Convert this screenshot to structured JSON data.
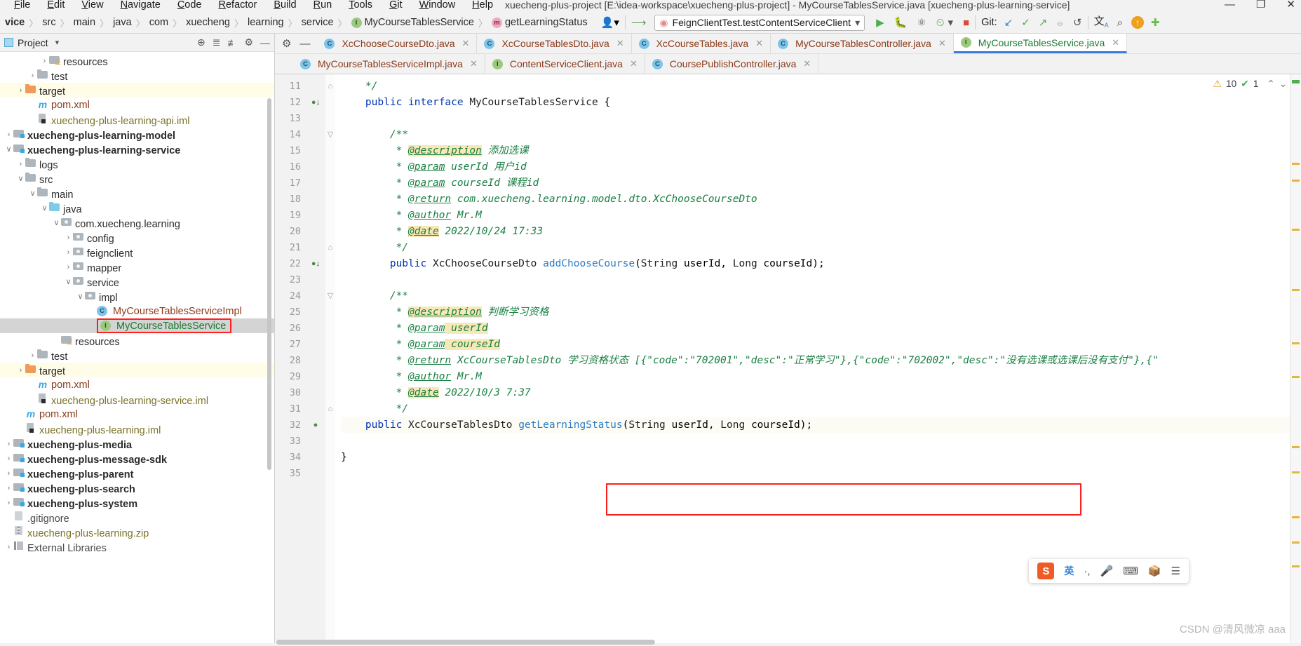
{
  "window": {
    "title": "xuecheng-plus-project [E:\\idea-workspace\\xuecheng-plus-project] - MyCourseTablesService.java [xuecheng-plus-learning-service]",
    "minimize": "—",
    "maximize": "❐",
    "close": "✕"
  },
  "menu": {
    "items": [
      "File",
      "Edit",
      "View",
      "Navigate",
      "Code",
      "Refactor",
      "Build",
      "Run",
      "Tools",
      "Git",
      "Window",
      "Help"
    ]
  },
  "breadcrumbs": {
    "items": [
      {
        "label": "vice",
        "bold": true,
        "icon": ""
      },
      {
        "label": "src",
        "bold": false,
        "icon": ""
      },
      {
        "label": "main",
        "bold": false,
        "icon": ""
      },
      {
        "label": "java",
        "bold": false,
        "icon": ""
      },
      {
        "label": "com",
        "bold": false,
        "icon": ""
      },
      {
        "label": "xuecheng",
        "bold": false,
        "icon": ""
      },
      {
        "label": "learning",
        "bold": false,
        "icon": ""
      },
      {
        "label": "service",
        "bold": false,
        "icon": ""
      },
      {
        "label": "MyCourseTablesService",
        "bold": false,
        "icon": "I"
      },
      {
        "label": "getLearningStatus",
        "bold": false,
        "icon": "m"
      }
    ]
  },
  "toolbar": {
    "profile_icon": "user-dropdown",
    "hammer_icon": "build-icon",
    "run_config": "FeignClientTest.testContentServiceClient",
    "run_icon": "▶",
    "debug_icon": "debug-icon",
    "coverage_icon": "run-with-coverage",
    "profiler_icon": "profile-icon",
    "stop_icon": "■",
    "git_label": "Git:",
    "git_update": "↙",
    "git_commit": "✓",
    "git_push": "↗",
    "git_history": "⦵",
    "git_rollback": "↺",
    "translate_icon": "translate-icon",
    "search_icon": "⌕",
    "updates_icon": "↑",
    "plugin_icon": "plugin-icon"
  },
  "project_panel": {
    "title": "Project",
    "dropdown": "▾",
    "locate_icon": "⊕",
    "expand_icon": "expand-all-icon",
    "collapse_icon": "collapse-all-icon",
    "settings_icon": "⚙",
    "hide_icon": "—",
    "tree": [
      {
        "indent": 3,
        "arrow": "›",
        "icon": "f-res",
        "label": "resources",
        "cls": "c-folder",
        "state": ""
      },
      {
        "indent": 2,
        "arrow": "›",
        "icon": "f-gray",
        "label": "test",
        "cls": "c-folder",
        "state": ""
      },
      {
        "indent": 1,
        "arrow": "›",
        "icon": "f-orange",
        "label": "target",
        "cls": "c-folder",
        "state": "hl-yellow"
      },
      {
        "indent": 2,
        "arrow": "",
        "icon": "ico-m",
        "label": "pom.xml",
        "cls": "c-xml",
        "state": ""
      },
      {
        "indent": 2,
        "arrow": "",
        "icon": "ico-iml",
        "label": "xuecheng-plus-learning-api.iml",
        "cls": "c-iml",
        "state": ""
      },
      {
        "indent": 0,
        "arrow": "›",
        "icon": "f-mod",
        "label": "xuecheng-plus-learning-model",
        "cls": "c-folder bold",
        "state": ""
      },
      {
        "indent": 0,
        "arrow": "∨",
        "icon": "f-mod",
        "label": "xuecheng-plus-learning-service",
        "cls": "c-folder bold",
        "state": ""
      },
      {
        "indent": 1,
        "arrow": "›",
        "icon": "f-gray",
        "label": "logs",
        "cls": "c-folder",
        "state": ""
      },
      {
        "indent": 1,
        "arrow": "∨",
        "icon": "f-gray",
        "label": "src",
        "cls": "c-folder",
        "state": ""
      },
      {
        "indent": 2,
        "arrow": "∨",
        "icon": "f-gray",
        "label": "main",
        "cls": "c-folder",
        "state": ""
      },
      {
        "indent": 3,
        "arrow": "∨",
        "icon": "f-blue",
        "label": "java",
        "cls": "c-folder",
        "state": ""
      },
      {
        "indent": 4,
        "arrow": "∨",
        "icon": "f-pkg",
        "label": "com.xuecheng.learning",
        "cls": "c-folder",
        "state": ""
      },
      {
        "indent": 5,
        "arrow": "›",
        "icon": "f-pkg",
        "label": "config",
        "cls": "c-folder",
        "state": ""
      },
      {
        "indent": 5,
        "arrow": "›",
        "icon": "f-pkg",
        "label": "feignclient",
        "cls": "c-folder",
        "state": ""
      },
      {
        "indent": 5,
        "arrow": "›",
        "icon": "f-pkg",
        "label": "mapper",
        "cls": "c-folder",
        "state": ""
      },
      {
        "indent": 5,
        "arrow": "∨",
        "icon": "f-pkg",
        "label": "service",
        "cls": "c-folder",
        "state": ""
      },
      {
        "indent": 6,
        "arrow": "∨",
        "icon": "f-pkg",
        "label": "impl",
        "cls": "c-folder",
        "state": ""
      },
      {
        "indent": 7,
        "arrow": "",
        "icon": "badge-c",
        "label": "MyCourseTablesServiceImpl",
        "cls": "c-brown",
        "state": ""
      },
      {
        "indent": 7,
        "arrow": "",
        "icon": "badge-i",
        "label": "MyCourseTablesService",
        "cls": "c-green",
        "state": "sel redbox"
      },
      {
        "indent": 4,
        "arrow": "",
        "icon": "f-res",
        "label": "resources",
        "cls": "c-folder",
        "state": ""
      },
      {
        "indent": 2,
        "arrow": "›",
        "icon": "f-gray",
        "label": "test",
        "cls": "c-folder",
        "state": ""
      },
      {
        "indent": 1,
        "arrow": "›",
        "icon": "f-orange",
        "label": "target",
        "cls": "c-folder",
        "state": "hl-yellow"
      },
      {
        "indent": 2,
        "arrow": "",
        "icon": "ico-m",
        "label": "pom.xml",
        "cls": "c-xml",
        "state": ""
      },
      {
        "indent": 2,
        "arrow": "",
        "icon": "ico-iml",
        "label": "xuecheng-plus-learning-service.iml",
        "cls": "c-iml",
        "state": ""
      },
      {
        "indent": 1,
        "arrow": "",
        "icon": "ico-m",
        "label": "pom.xml",
        "cls": "c-xml",
        "state": ""
      },
      {
        "indent": 1,
        "arrow": "",
        "icon": "ico-iml",
        "label": "xuecheng-plus-learning.iml",
        "cls": "c-iml",
        "state": ""
      },
      {
        "indent": 0,
        "arrow": "›",
        "icon": "f-mod",
        "label": "xuecheng-plus-media",
        "cls": "c-folder bold",
        "state": ""
      },
      {
        "indent": 0,
        "arrow": "›",
        "icon": "f-mod",
        "label": "xuecheng-plus-message-sdk",
        "cls": "c-folder bold",
        "state": ""
      },
      {
        "indent": 0,
        "arrow": "›",
        "icon": "f-mod",
        "label": "xuecheng-plus-parent",
        "cls": "c-folder bold",
        "state": ""
      },
      {
        "indent": 0,
        "arrow": "›",
        "icon": "f-mod",
        "label": "xuecheng-plus-search",
        "cls": "c-folder bold",
        "state": ""
      },
      {
        "indent": 0,
        "arrow": "›",
        "icon": "f-mod",
        "label": "xuecheng-plus-system",
        "cls": "c-folder bold",
        "state": ""
      },
      {
        "indent": 0,
        "arrow": "",
        "icon": "ico-git",
        "label": ".gitignore",
        "cls": "c-dim",
        "state": ""
      },
      {
        "indent": 0,
        "arrow": "",
        "icon": "ico-zip",
        "label": "xuecheng-plus-learning.zip",
        "cls": "c-zip",
        "state": ""
      },
      {
        "indent": 0,
        "arrow": "›",
        "icon": "ico-lib",
        "label": "External Libraries",
        "cls": "c-dim",
        "state": ""
      }
    ]
  },
  "editor_tabs": {
    "row1": [
      {
        "label": "XcChooseCourseDto.java",
        "icon": "C",
        "active": false
      },
      {
        "label": "XcCourseTablesDto.java",
        "icon": "C",
        "active": false
      },
      {
        "label": "XcCourseTables.java",
        "icon": "C",
        "active": false
      },
      {
        "label": "MyCourseTablesController.java",
        "icon": "C",
        "active": false
      },
      {
        "label": "MyCourseTablesService.java",
        "icon": "I",
        "active": true
      }
    ],
    "row2": [
      {
        "label": "MyCourseTablesServiceImpl.java",
        "icon": "C",
        "active": false
      },
      {
        "label": "ContentServiceClient.java",
        "icon": "I",
        "active": false
      },
      {
        "label": "CoursePublishController.java",
        "icon": "C",
        "active": false
      }
    ],
    "close_glyph": "✕"
  },
  "inspection": {
    "warning_count": "10",
    "ok_count": "1",
    "warning_glyph": "⚠",
    "ok_glyph": "✔",
    "up_glyph": "⌃",
    "down_glyph": "⌄",
    "gear_glyph": "⚙"
  },
  "code": {
    "first_line": 11,
    "lines": [
      {
        "n": 11,
        "fold": "⌂",
        "marker": "",
        "html": "    <span class='cmt'>*/</span>"
      },
      {
        "n": 12,
        "fold": "",
        "marker": "impl-down",
        "html": "    <span class='kw'>public</span> <span class='kw'>interface</span> <span class='typ'>MyCourseTablesService</span> {"
      },
      {
        "n": 13,
        "fold": "",
        "marker": "",
        "html": ""
      },
      {
        "n": 14,
        "fold": "▽",
        "marker": "",
        "html": "        <span class='cmt'>/**</span>"
      },
      {
        "n": 15,
        "fold": "",
        "marker": "",
        "html": "         <span class='cmt'>* </span><span class='tag hl'>@description</span><span class='cmt'> 添加选课</span>"
      },
      {
        "n": 16,
        "fold": "",
        "marker": "",
        "html": "         <span class='cmt'>* </span><span class='tag'>@param</span><span class='cmt'> userId 用户id</span>"
      },
      {
        "n": 17,
        "fold": "",
        "marker": "",
        "html": "         <span class='cmt'>* </span><span class='tag'>@param</span><span class='cmt'> courseId 课程id</span>"
      },
      {
        "n": 18,
        "fold": "",
        "marker": "",
        "html": "         <span class='cmt'>* </span><span class='tag'>@return</span><span class='cmt'> com.xuecheng.learning.model.dto.XcChooseCourseDto</span>"
      },
      {
        "n": 19,
        "fold": "",
        "marker": "",
        "html": "         <span class='cmt'>* </span><span class='tag'>@author</span><span class='cmt'> Mr.M</span>"
      },
      {
        "n": 20,
        "fold": "",
        "marker": "",
        "html": "         <span class='cmt'>* </span><span class='tag hl'>@date</span><span class='cmt'> 2022/10/24 17:33</span>"
      },
      {
        "n": 21,
        "fold": "⌂",
        "marker": "",
        "html": "         <span class='cmt'>*/</span>"
      },
      {
        "n": 22,
        "fold": "",
        "marker": "impl-down",
        "html": "        <span class='kw'>public</span> <span class='typ'>XcChooseCourseDto</span> <span class='mth'>addChooseCourse</span>(<span class='typ'>String</span> userId, <span class='typ'>Long</span> courseId);"
      },
      {
        "n": 23,
        "fold": "",
        "marker": "",
        "html": ""
      },
      {
        "n": 24,
        "fold": "▽",
        "marker": "",
        "html": "        <span class='cmt'>/**</span>"
      },
      {
        "n": 25,
        "fold": "",
        "marker": "",
        "html": "         <span class='cmt'>* </span><span class='tag hl'>@description</span><span class='cmt'> 判断学习资格</span>"
      },
      {
        "n": 26,
        "fold": "",
        "marker": "",
        "html": "         <span class='cmt'>* </span><span class='tag'>@param</span><span class='cmt hl'> userId</span>"
      },
      {
        "n": 27,
        "fold": "",
        "marker": "",
        "html": "         <span class='cmt'>* </span><span class='tag'>@param</span><span class='cmt hl'> courseId</span>"
      },
      {
        "n": 28,
        "fold": "",
        "marker": "",
        "html": "         <span class='cmt'>* </span><span class='tag'>@return</span><span class='cmt'> XcCourseTablesDto 学习资格状态 [{\"code\":\"702001\",\"desc\":\"正常学习\"},{\"code\":\"702002\",\"desc\":\"没有选课或选课后没有支付\"},{\"</span>"
      },
      {
        "n": 29,
        "fold": "",
        "marker": "",
        "html": "         <span class='cmt'>* </span><span class='tag'>@author</span><span class='cmt'> Mr.M</span>"
      },
      {
        "n": 30,
        "fold": "",
        "marker": "",
        "html": "         <span class='cmt'>* </span><span class='tag hl'>@date</span><span class='cmt'> 2022/10/3 7:37</span>"
      },
      {
        "n": 31,
        "fold": "⌂",
        "marker": "",
        "html": "         <span class='cmt'>*/</span>"
      },
      {
        "n": 32,
        "fold": "",
        "marker": "impl-bulb",
        "html": "    <span class='kw'>public</span> <span class='typ'>XcCourseTablesDto</span> <span class='mth'>getLearningStatus</span>(<span class='typ'>String</span> userId, <span class='typ'>Long</span> courseId);"
      },
      {
        "n": 33,
        "fold": "",
        "marker": "",
        "html": ""
      },
      {
        "n": 34,
        "fold": "",
        "marker": "",
        "html": "}"
      },
      {
        "n": 35,
        "fold": "",
        "marker": "",
        "html": ""
      }
    ]
  },
  "ime": {
    "logo": "S",
    "mode": "英",
    "punct": "·,",
    "mic_icon": "🎤",
    "keyboard_icon": "⌨",
    "toolbox_icon": "🧰",
    "menu_icon": "≡"
  },
  "watermark": "CSDN @清风微凉 aaa"
}
